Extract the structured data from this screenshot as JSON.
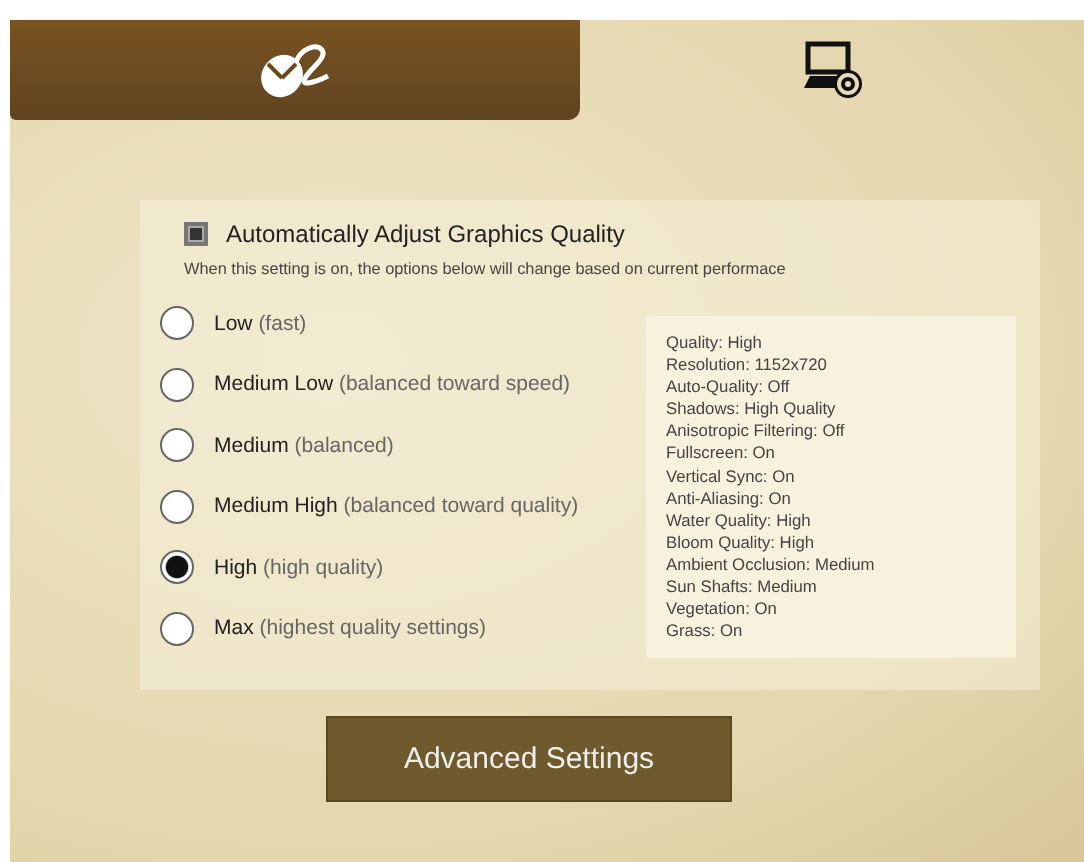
{
  "tabs": [
    {
      "kind": "mouse",
      "selected": true
    },
    {
      "kind": "display",
      "selected": false
    }
  ],
  "auto_adjust": {
    "label": "Automatically Adjust Graphics Quality",
    "checked": true,
    "description": "When this setting is on, the options below will change based on current performace"
  },
  "quality_options": [
    {
      "name": "Low",
      "note": "(fast)",
      "selected": false
    },
    {
      "name": "Medium Low",
      "note": "(balanced toward speed)",
      "selected": false
    },
    {
      "name": "Medium",
      "note": "(balanced)",
      "selected": false
    },
    {
      "name": "Medium High",
      "note": "(balanced toward quality)",
      "selected": false
    },
    {
      "name": "High",
      "note": "(high quality)",
      "selected": true
    },
    {
      "name": "Max",
      "note": "(highest quality settings)",
      "selected": false
    }
  ],
  "summary": [
    "Quality: High",
    "Resolution: 1152x720",
    "Auto-Quality: Off",
    "Shadows: High Quality",
    "Anisotropic Filtering: Off",
    "Fullscreen: On",
    "Vertical Sync: On",
    "Anti-Aliasing: On",
    "Water Quality: High",
    "Bloom Quality: High",
    "Ambient Occlusion: Medium",
    "Sun Shafts: Medium",
    "Vegetation: On",
    "Grass: On"
  ],
  "buttons": [
    "Advanced Settings"
  ]
}
